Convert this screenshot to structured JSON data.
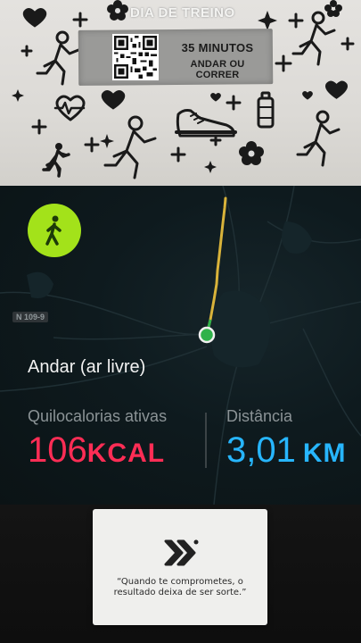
{
  "flyer": {
    "title": "DIA DE TREINO",
    "banner_line1": "35 MINUTOS",
    "banner_line2": "ANDAR OU CORRER"
  },
  "workout": {
    "activity_icon": "walking-person-icon",
    "road_label": "N 109-9",
    "activity_name": "Andar (ar livre)",
    "calories": {
      "label": "Quilocalorias ativas",
      "value": "106",
      "unit": "KCAL",
      "color": "#ff2d55"
    },
    "distance": {
      "label": "Distância",
      "value": "3,01",
      "unit": "KM",
      "color": "#27b6ff"
    },
    "route_colors": [
      "#2fb24a",
      "#d6c83a",
      "#d9b33a"
    ]
  },
  "quote_card": {
    "logo": "double-chevron-logo",
    "quote": "“Quando te comprometes, o resultado deixa de ser sorte.”"
  }
}
